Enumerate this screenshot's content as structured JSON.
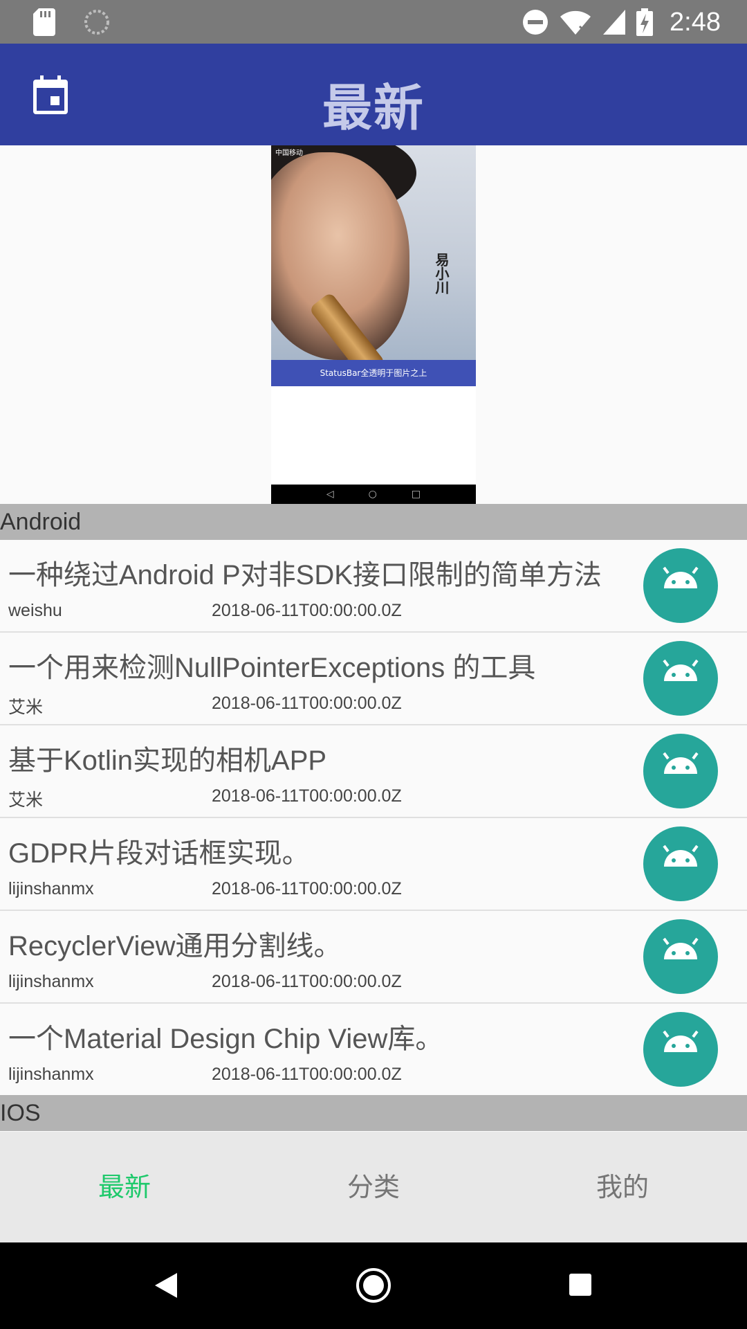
{
  "status_bar": {
    "time": "2:48",
    "icons": [
      "sd-card-icon",
      "loading-icon",
      "do-not-disturb-icon",
      "wifi-icon",
      "signal-icon",
      "battery-charging-icon"
    ]
  },
  "app_bar": {
    "title": "最新",
    "icon": "calendar-icon"
  },
  "banner": {
    "carrier": "中国移动",
    "poster_name": "易小川",
    "caption": "StatusBar全透明于图片之上"
  },
  "sections": [
    {
      "header": "Android",
      "items": [
        {
          "title": "一种绕过Android P对非SDK接口限制的简单方法",
          "author": "weishu",
          "date": "2018-06-11T00:00:00.0Z"
        },
        {
          "title": "一个用来检测NullPointerExceptions 的工具",
          "author": "艾米",
          "date": "2018-06-11T00:00:00.0Z"
        },
        {
          "title": "基于Kotlin实现的相机APP",
          "author": "艾米",
          "date": "2018-06-11T00:00:00.0Z"
        },
        {
          "title": "GDPR片段对话框实现。",
          "author": "lijinshanmx",
          "date": "2018-06-11T00:00:00.0Z"
        },
        {
          "title": "RecyclerView通用分割线。",
          "author": "lijinshanmx",
          "date": "2018-06-11T00:00:00.0Z"
        },
        {
          "title": "一个Material Design Chip View库。",
          "author": "lijinshanmx",
          "date": "2018-06-11T00:00:00.0Z"
        }
      ]
    },
    {
      "header": "IOS",
      "items": []
    }
  ],
  "bottom_nav": {
    "tabs": [
      {
        "label": "最新",
        "active": true
      },
      {
        "label": "分类",
        "active": false
      },
      {
        "label": "我的",
        "active": false
      }
    ],
    "active_color": "#1ec96b"
  },
  "colors": {
    "primary": "#303f9f",
    "title_text": "#c5cae9",
    "avatar_bg": "#26a69a",
    "section_header_bg": "#b3b3b3"
  }
}
